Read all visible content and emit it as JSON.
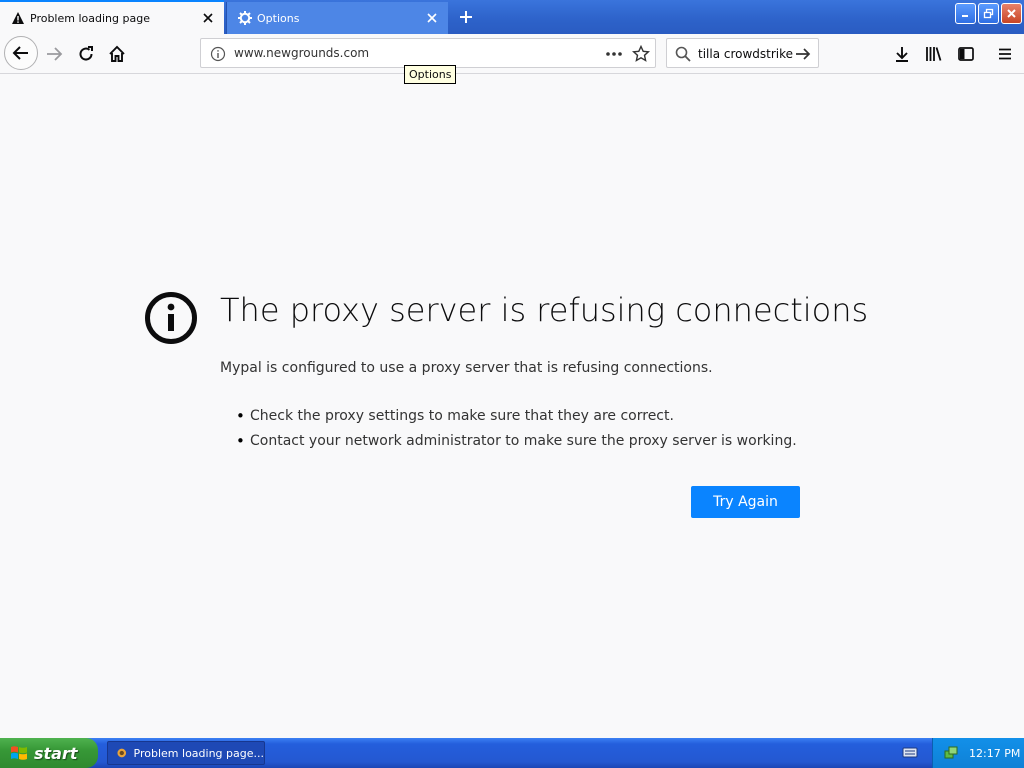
{
  "tabs": [
    {
      "label": "Problem loading page",
      "icon": "warning-icon",
      "active": true
    },
    {
      "label": "Options",
      "icon": "gear-icon",
      "active": false
    }
  ],
  "toolbar": {
    "url": "www.newgrounds.com",
    "search_value": "tilla crowdstrike",
    "tooltip": "Options"
  },
  "error": {
    "title": "The proxy server is refusing connections",
    "description": "Mypal is configured to use a proxy server that is refusing connections.",
    "suggestions": [
      "Check the proxy settings to make sure that they are correct.",
      "Contact your network administrator to make sure the proxy server is working."
    ],
    "button_label": "Try Again"
  },
  "taskbar": {
    "start_label": "start",
    "window_label": "Problem loading page...",
    "clock": "12:17 PM"
  },
  "colors": {
    "accent": "#0a84ff",
    "page_bg": "#f9f9fa",
    "taskbar": "#245edc",
    "start": "#379837"
  }
}
